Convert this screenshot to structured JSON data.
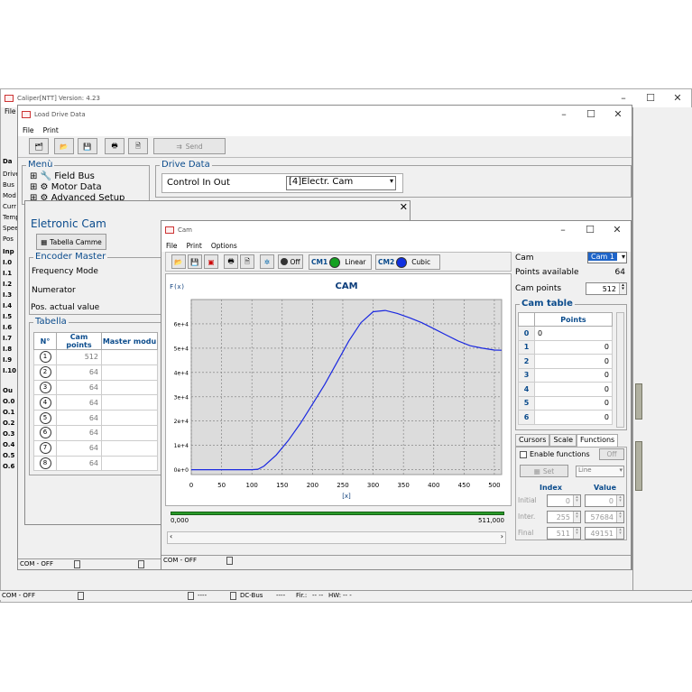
{
  "main_window": {
    "title": "Caliper[NTT] Version: 4.23",
    "menu_first": "File"
  },
  "main_left_labels": [
    "Da",
    "Drive",
    "Bus",
    "Mod",
    "Curr",
    "Temp",
    "Spee",
    "Pos",
    "Inp",
    "I.0",
    "I.1",
    "I.2",
    "I.3",
    "I.4",
    "I.5",
    "I.6",
    "I.7",
    "I.8",
    "I.9",
    "I.10",
    "Ou",
    "O.0",
    "O.1",
    "O.2",
    "O.3",
    "O.4",
    "O.5",
    "O.6"
  ],
  "main_status": {
    "com": "COM - OFF",
    "dash": "----",
    "dcbus": "DC-Bus",
    "dcbus_val": "----",
    "fir_label": "Fir.:",
    "fir_val": "-- --",
    "hw_label": "HW:",
    "hw_val": "-- -"
  },
  "load_window": {
    "title": "Load Drive Data",
    "menu": [
      "File",
      "Print"
    ],
    "send_label": "Send",
    "menu_panel_label": "Menù",
    "tree": [
      "Field Bus",
      "Motor Data",
      "Advanced Setup"
    ],
    "drive_data_label": "Drive Data",
    "control_label": "Control In Out",
    "control_value": "[4]Electr. Cam",
    "status_com": "COM - OFF"
  },
  "ecam_window": {
    "title": "Eletronic Cam",
    "tabella_button": "Tabella Camme",
    "encoder_label": "Encoder Master",
    "rows": [
      "Frequency Mode",
      "Numerator",
      "Pos. actual value"
    ],
    "tabella_label": "Tabella",
    "headers": [
      "N°",
      "Cam points",
      "Master modu"
    ],
    "table": [
      {
        "n": "1",
        "pts": "512"
      },
      {
        "n": "2",
        "pts": "64"
      },
      {
        "n": "3",
        "pts": "64"
      },
      {
        "n": "4",
        "pts": "64"
      },
      {
        "n": "5",
        "pts": "64"
      },
      {
        "n": "6",
        "pts": "64"
      },
      {
        "n": "7",
        "pts": "64"
      },
      {
        "n": "8",
        "pts": "64"
      }
    ]
  },
  "cam_window": {
    "title": "Cam",
    "menu": [
      "File",
      "Print",
      "Options"
    ],
    "off_label": "Off",
    "cm1": "CM1",
    "cm1_mode": "Linear",
    "cm1_color": "#14a020",
    "cm2": "CM2",
    "cm2_mode": "Cubic",
    "cm2_color": "#1030e0",
    "slider_left": "0,000",
    "slider_right": "511,000",
    "status_com": "COM - OFF",
    "right": {
      "cam_label": "Cam",
      "cam_value": "Cam 1",
      "points_available_label": "Points available",
      "points_available": "64",
      "cam_points_label": "Cam points",
      "cam_points": "512",
      "cam_table_label": "Cam table",
      "points_header": "Points",
      "rows": [
        {
          "i": "0",
          "v": "0"
        },
        {
          "i": "1",
          "v": "0"
        },
        {
          "i": "2",
          "v": "0"
        },
        {
          "i": "3",
          "v": "0"
        },
        {
          "i": "4",
          "v": "0"
        },
        {
          "i": "5",
          "v": "0"
        },
        {
          "i": "6",
          "v": "0"
        }
      ],
      "tabs": [
        "Cursors",
        "Scale",
        "Functions"
      ],
      "enable_label": "Enable functions",
      "off_btn": "Off",
      "set_btn": "Set",
      "line_select": "Line",
      "index_header": "Index",
      "value_header": "Value",
      "func_rows": [
        {
          "label": "Initial",
          "idx": "0",
          "val": "0"
        },
        {
          "label": "Inter.",
          "idx": "255",
          "val": "57684"
        },
        {
          "label": "Final",
          "idx": "511",
          "val": "49151"
        }
      ]
    }
  },
  "chart_data": {
    "type": "line",
    "title": "CAM",
    "ylabel": "F(x)",
    "xlabel": "[x]",
    "xlim": [
      0,
      512
    ],
    "ylim": [
      -2000.0,
      70000.0
    ],
    "x_ticks": [
      "0",
      "50",
      "100",
      "150",
      "200",
      "250",
      "300",
      "350",
      "400",
      "450",
      "500"
    ],
    "y_ticks": [
      "0e+0",
      "1e+4",
      "2e+4",
      "3e+4",
      "4e+4",
      "5e+4",
      "6e+4"
    ],
    "grid": true,
    "series": [
      {
        "x": [
          0,
          100,
          110,
          120,
          140,
          160,
          180,
          200,
          220,
          240,
          260,
          280,
          300,
          320,
          340,
          360,
          380,
          400,
          420,
          440,
          460,
          480,
          500,
          512
        ],
        "y": [
          0,
          0,
          200,
          1500,
          6000,
          12000,
          19000,
          27000,
          35000,
          44000,
          53000,
          60500,
          65000,
          65500,
          64300,
          62500,
          60500,
          58000,
          55500,
          53000,
          51000,
          50000,
          49200,
          49151
        ]
      }
    ]
  }
}
